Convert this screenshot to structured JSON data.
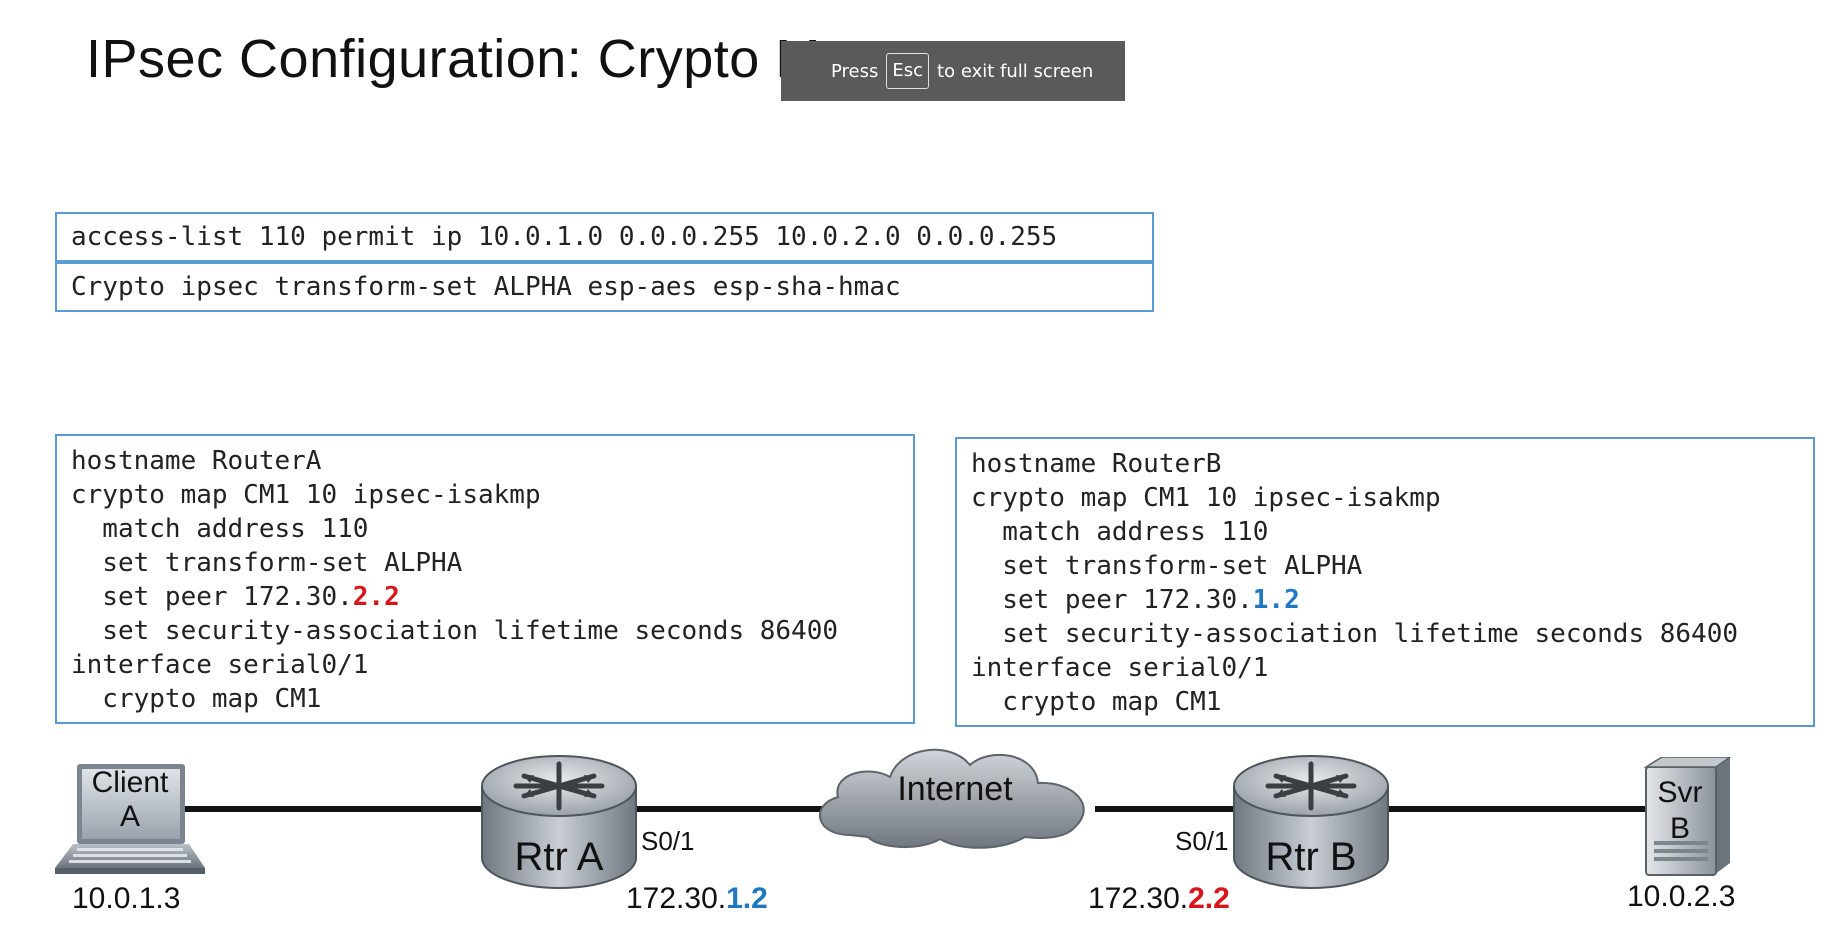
{
  "slide": {
    "title": "IPsec Configuration: Crypto Maps"
  },
  "fullscreen_notice": {
    "press": "Press",
    "key": "Esc",
    "suffix": "to exit full screen"
  },
  "global_config": {
    "acl": "access-list 110 permit ip 10.0.1.0 0.0.0.255 10.0.2.0 0.0.0.255",
    "transform": "Crypto ipsec transform-set ALPHA esp-aes esp-sha-hmac"
  },
  "router_a_config": {
    "hostname": "hostname RouterA",
    "crypto_map": "crypto map CM1 10 ipsec-isakmp",
    "match": "  match address 110",
    "transform": "  set transform-set ALPHA",
    "peer_prefix": "  set peer 172.30.",
    "peer_suffix": "2.2",
    "lifetime": "  set security-association lifetime seconds 86400",
    "interface": "interface serial0/1",
    "apply": "  crypto map CM1"
  },
  "router_b_config": {
    "hostname": "hostname RouterB",
    "crypto_map": "crypto map CM1 10 ipsec-isakmp",
    "match": "  match address 110",
    "transform": "  set transform-set ALPHA",
    "peer_prefix": "  set peer 172.30.",
    "peer_suffix": "1.2",
    "lifetime": "  set security-association lifetime seconds 86400",
    "interface": "interface serial0/1",
    "apply": "  crypto map CM1"
  },
  "topology": {
    "client": {
      "line1": "Client",
      "line2": "A",
      "ip": "10.0.1.3"
    },
    "rtr_a": {
      "name": "Rtr A",
      "iface": "S0/1",
      "ip_prefix": "172.30.",
      "ip_suffix": "1.2"
    },
    "internet": {
      "label": "Internet"
    },
    "rtr_b": {
      "name": "Rtr B",
      "iface": "S0/1",
      "ip_prefix": "172.30.",
      "ip_suffix": "2.2"
    },
    "server": {
      "line1": "Svr",
      "line2": "B",
      "ip": "10.0.2.3"
    }
  },
  "colors": {
    "box_border": "#5b9bd5",
    "peer_red": "#d8151b",
    "peer_blue": "#1f78c1"
  }
}
